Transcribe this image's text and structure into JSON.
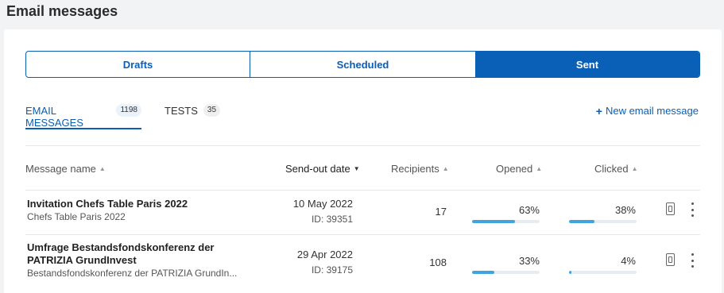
{
  "page": {
    "title": "Email messages"
  },
  "segments": [
    {
      "label": "Drafts",
      "active": false
    },
    {
      "label": "Scheduled",
      "active": false
    },
    {
      "label": "Sent",
      "active": true
    }
  ],
  "tabs": [
    {
      "label": "EMAIL MESSAGES",
      "count": "1198",
      "active": true
    },
    {
      "label": "TESTS",
      "count": "35",
      "active": false
    }
  ],
  "actions": {
    "new_label": "New email message",
    "plus_glyph": "+"
  },
  "columns": {
    "name": "Message name",
    "date": "Send-out date",
    "recipients": "Recipients",
    "opened": "Opened",
    "clicked": "Clicked",
    "sort_asc_glyph": "▲",
    "sort_desc_glyph": "▼"
  },
  "rows": [
    {
      "name": "Invitation Chefs Table Paris 2022",
      "subtitle": "Chefs Table Paris 2022",
      "date": "10 May 2022",
      "id": "ID: 39351",
      "recipients": "17",
      "opened": "63%",
      "opened_value": 63,
      "clicked": "38%",
      "clicked_value": 38
    },
    {
      "name": "Umfrage Bestandsfondskonferenz der PATRIZIA GrundInvest",
      "subtitle": "Bestandsfondskonferenz der PATRIZIA GrundIn...",
      "date": "29 Apr 2022",
      "id": "ID: 39175",
      "recipients": "108",
      "opened": "33%",
      "opened_value": 33,
      "clicked": "4%",
      "clicked_value": 4
    }
  ],
  "colors": {
    "accent": "#0a5fb4",
    "bar_fill": "#3fa3df",
    "bar_track": "#e8ecf1"
  }
}
